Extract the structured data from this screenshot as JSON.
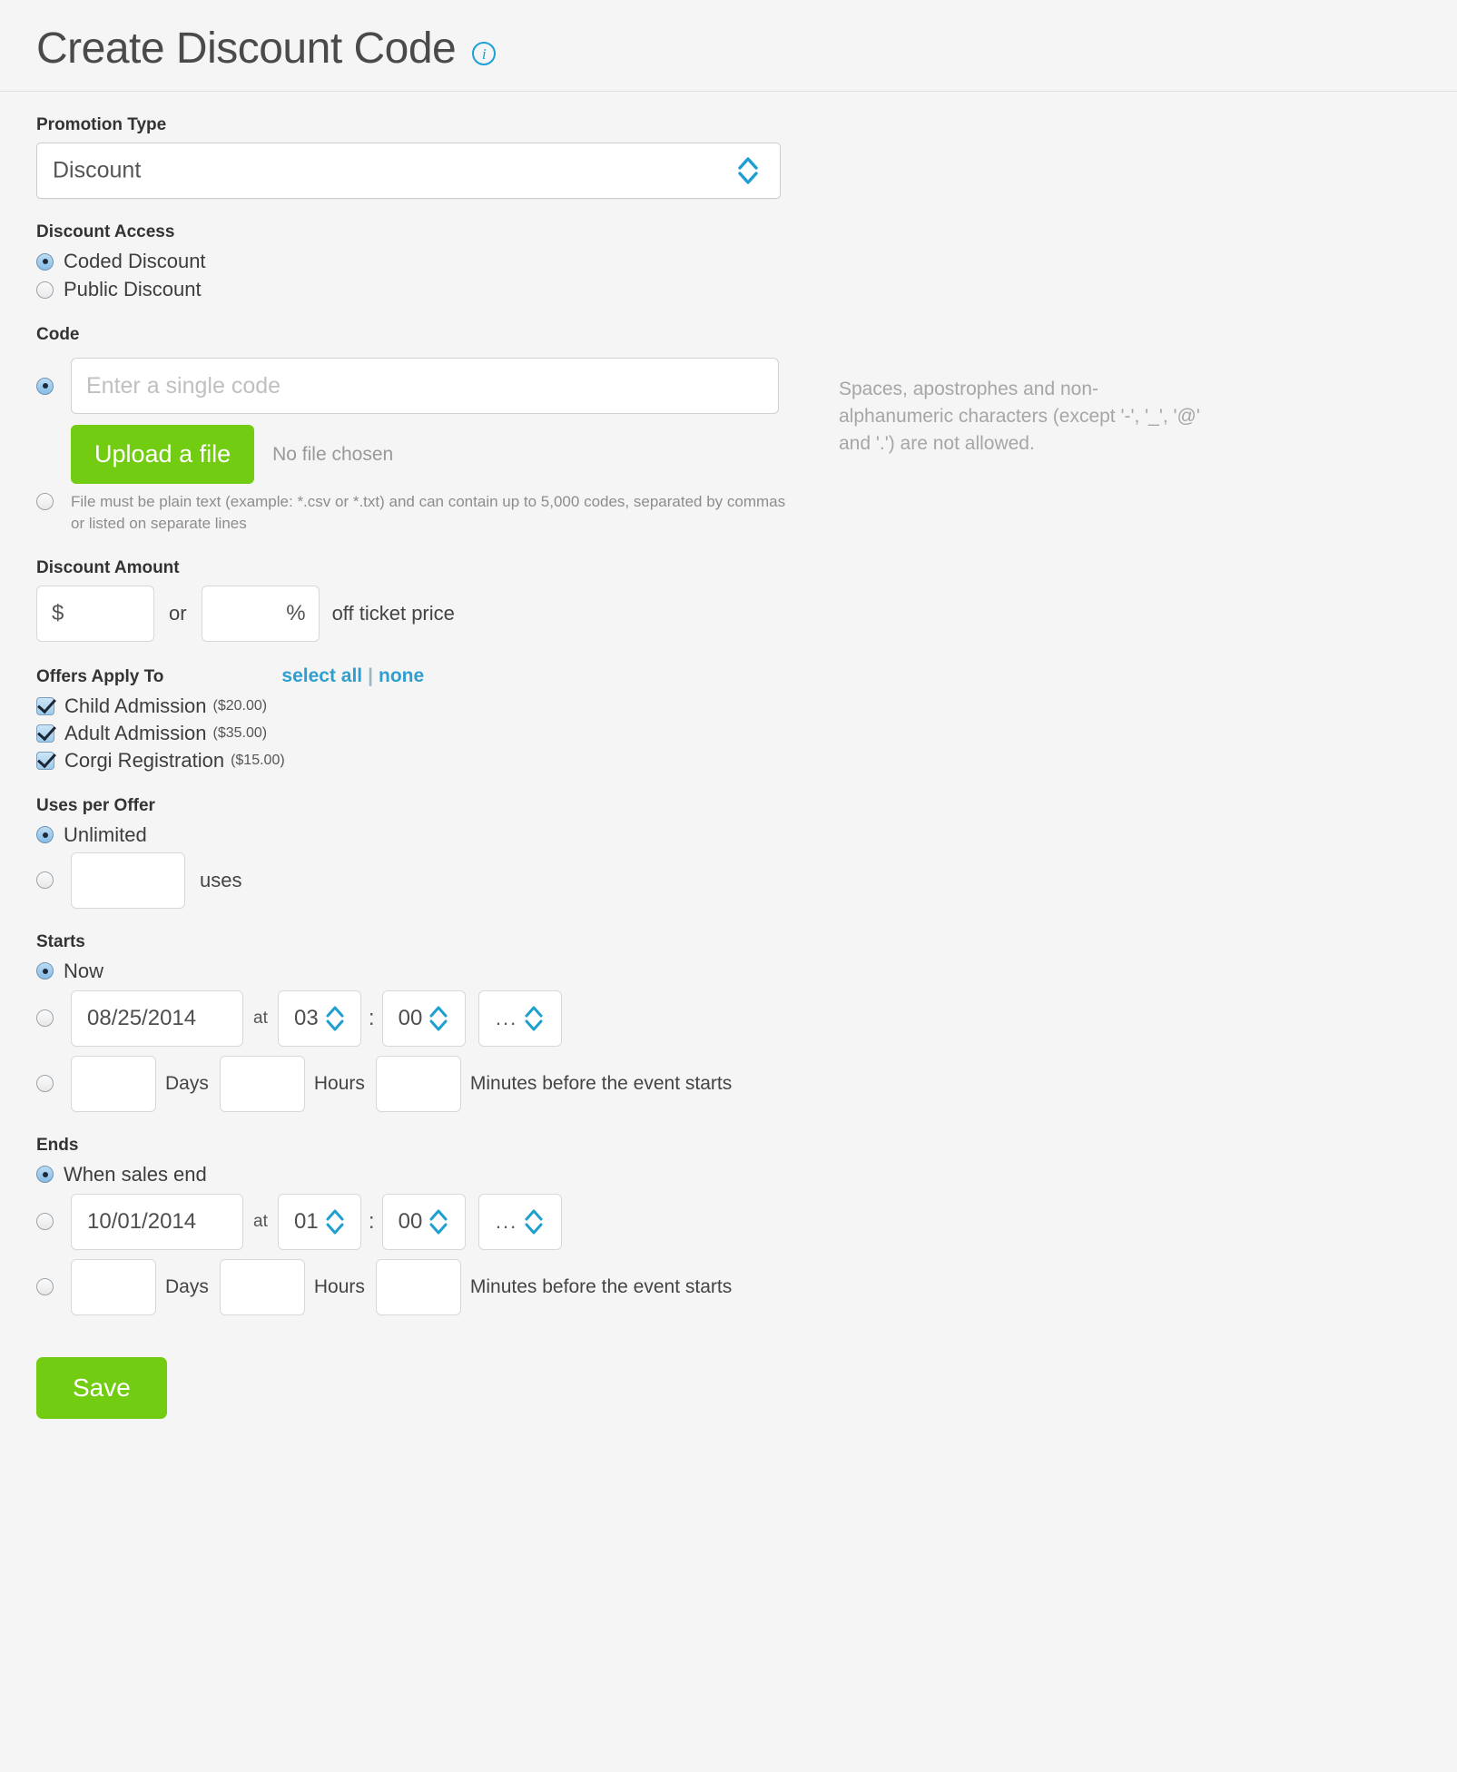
{
  "header": {
    "title": "Create Discount Code",
    "info_icon": "info-icon",
    "info_glyph": "i"
  },
  "promotion_type": {
    "label": "Promotion Type",
    "value": "Discount",
    "options": [
      "Discount"
    ]
  },
  "discount_access": {
    "label": "Discount Access",
    "options": [
      {
        "label": "Coded Discount",
        "selected": true
      },
      {
        "label": "Public Discount",
        "selected": false
      }
    ]
  },
  "code": {
    "label": "Code",
    "single_code_selected": true,
    "input_value": "",
    "input_placeholder": "Enter a single code",
    "upload_selected": false,
    "upload_button_label": "Upload a file",
    "file_status": "No file chosen",
    "upload_help": "File must be plain text (example: *.csv or *.txt) and can contain up to 5,000 codes, separated by commas or listed on separate lines",
    "side_help": "Spaces, apostrophes and non-alphanumeric characters (except '-', '_', '@' and '.') are not allowed."
  },
  "discount_amount": {
    "label": "Discount Amount",
    "dollar_symbol": "$",
    "dollar_value": "",
    "or_text": "or",
    "percent_symbol": "%",
    "percent_value": "",
    "suffix": "off ticket price"
  },
  "offers_apply_to": {
    "label": "Offers Apply To",
    "select_all_label": "select all",
    "separator": "|",
    "none_label": "none",
    "items": [
      {
        "name": "Child Admission",
        "price": "($20.00)",
        "checked": true
      },
      {
        "name": "Adult Admission",
        "price": "($35.00)",
        "checked": true
      },
      {
        "name": "Corgi Registration",
        "price": "($15.00)",
        "checked": true
      }
    ]
  },
  "uses_per_offer": {
    "label": "Uses per Offer",
    "unlimited_label": "Unlimited",
    "unlimited_selected": true,
    "count_selected": false,
    "count_value": "",
    "count_suffix": "uses"
  },
  "starts": {
    "label": "Starts",
    "now_label": "Now",
    "now_selected": true,
    "date_selected": false,
    "date_value": "08/25/2014",
    "at_text": "at",
    "hour_value": "03",
    "colon": ":",
    "minute_value": "00",
    "meridiem_value": "...",
    "relative_selected": false,
    "days_value": "",
    "days_label": "Days",
    "hours_value": "",
    "hours_label": "Hours",
    "minutes_value": "",
    "minutes_label": "Minutes before the event starts"
  },
  "ends": {
    "label": "Ends",
    "when_sales_end_label": "When sales end",
    "when_sales_end_selected": true,
    "date_selected": false,
    "date_value": "10/01/2014",
    "at_text": "at",
    "hour_value": "01",
    "colon": ":",
    "minute_value": "00",
    "meridiem_value": "...",
    "relative_selected": false,
    "days_value": "",
    "days_label": "Days",
    "hours_value": "",
    "hours_label": "Hours",
    "minutes_value": "",
    "minutes_label": "Minutes before the event starts"
  },
  "footer": {
    "save_label": "Save"
  },
  "colors": {
    "green": "#72cc12",
    "link_blue": "#2f9fd0",
    "info_blue": "#1ba0d7",
    "page_bg": "#f5f5f5"
  }
}
